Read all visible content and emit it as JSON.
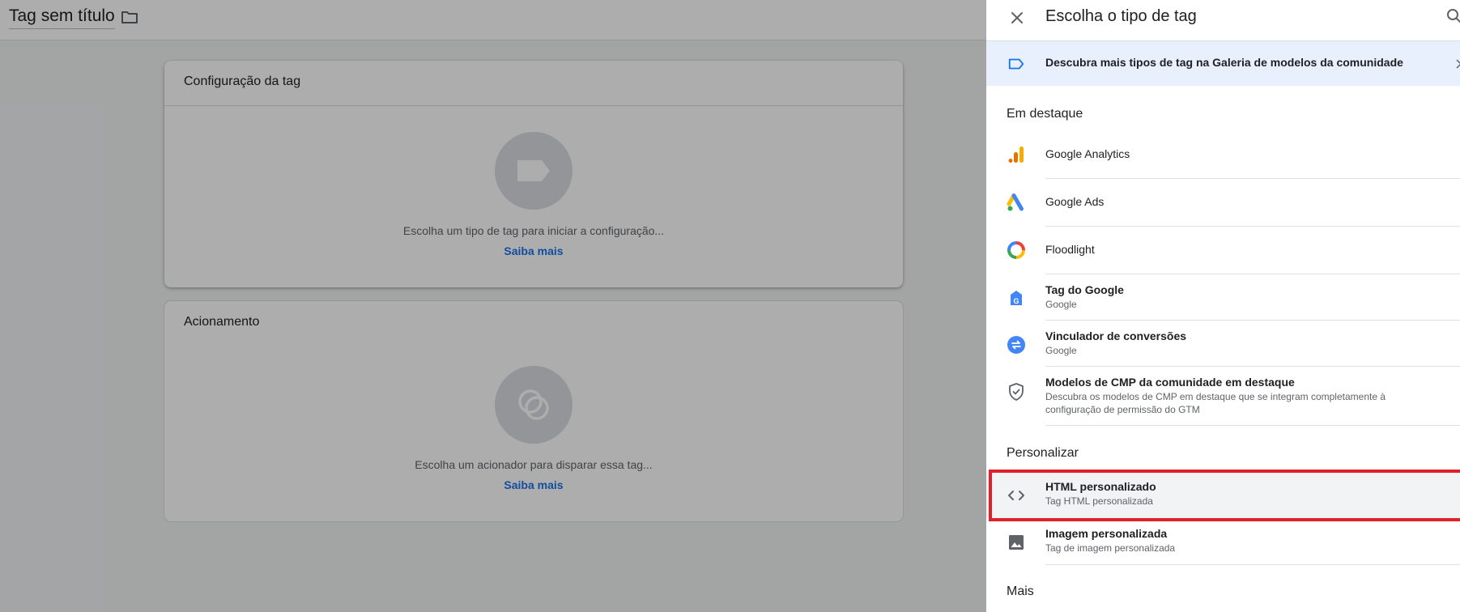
{
  "editor": {
    "tag_name": "Tag sem título",
    "config_card": {
      "title": "Configuração da tag",
      "hint": "Escolha um tipo de tag para iniciar a configuração...",
      "link": "Saiba mais"
    },
    "trigger_card": {
      "title": "Acionamento",
      "hint": "Escolha um acionador para disparar essa tag...",
      "link": "Saiba mais"
    }
  },
  "panel": {
    "title": "Escolha o tipo de tag",
    "gallery_banner": "Descubra mais tipos de tag na Galeria de modelos da comunidade",
    "sections": {
      "featured": "Em destaque",
      "custom": "Personalizar",
      "more": "Mais"
    },
    "featured_items": [
      {
        "title": "Google Analytics",
        "icon": "google-analytics-icon"
      },
      {
        "title": "Google Ads",
        "icon": "google-ads-icon"
      },
      {
        "title": "Floodlight",
        "icon": "floodlight-icon"
      },
      {
        "title": "Tag do Google",
        "subtitle": "Google",
        "icon": "google-tag-icon"
      },
      {
        "title": "Vinculador de conversões",
        "subtitle": "Google",
        "icon": "conversion-linker-icon"
      },
      {
        "title": "Modelos de CMP da comunidade em destaque",
        "subtitle": "Descubra os modelos de CMP em destaque que se integram completamente à configuração de permissão do GTM",
        "icon": "shield-icon"
      }
    ],
    "custom_items": [
      {
        "title": "HTML personalizado",
        "subtitle": "Tag HTML personalizada",
        "icon": "code-icon",
        "highlighted": true
      },
      {
        "title": "Imagem personalizada",
        "subtitle": "Tag de imagem personalizada",
        "icon": "image-icon"
      }
    ]
  },
  "colors": {
    "accent_blue": "#1a73e8",
    "banner_bg": "#e8f0fe",
    "highlight_red": "#e0202a",
    "overlay": "rgba(0,0,0,0.32)"
  }
}
